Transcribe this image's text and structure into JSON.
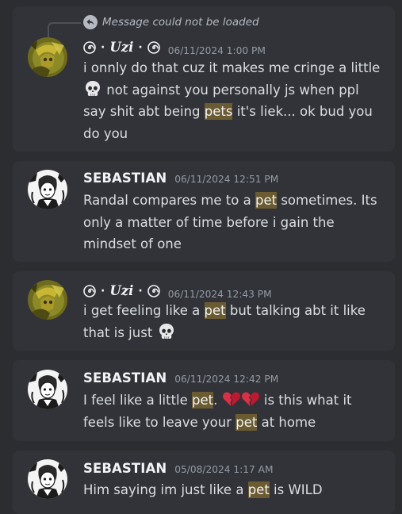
{
  "messages": [
    {
      "reply_text": "Message could not be loaded",
      "author": "Uzi",
      "author_prefix": "·",
      "author_suffix": "·",
      "timestamp": "06/11/2024 1:00 PM",
      "content": {
        "t1": "i onnly do that cuz it makes me cringe a little",
        "t2": " not against you personally js when ppl say shit abt being ",
        "hl1": "pets",
        "t3": " it's liek... ok bud you do you"
      }
    },
    {
      "author": "SEBASTIAN",
      "timestamp": "06/11/2024 12:51 PM",
      "content": {
        "t1": "Randal compares me to a ",
        "hl1": "pet",
        "t2": " sometimes. Its only a matter of time before i gain the mindset of one"
      }
    },
    {
      "author": "Uzi",
      "author_prefix": "·",
      "author_suffix": "·",
      "timestamp": "06/11/2024 12:43 PM",
      "content": {
        "t1": "i get feeling like a ",
        "hl1": "pet",
        "t2": " but talking abt it like that is just "
      }
    },
    {
      "author": "SEBASTIAN",
      "timestamp": "06/11/2024 12:42 PM",
      "content": {
        "t1": "I feel like a little ",
        "hl1": "pet",
        "t2": ". ",
        "t3": " is this what it feels like to leave your ",
        "hl2": "pet",
        "t4": "  at home"
      }
    },
    {
      "author": "SEBASTIAN",
      "timestamp": "05/08/2024 1:17 AM",
      "content": {
        "t1": "Him saying im just like a ",
        "hl1": "pet",
        "t2": " is WILD"
      }
    }
  ],
  "colors": {
    "background": "#2b2d31",
    "card": "#313338",
    "highlight": "#6b5b30",
    "text": "#dbdee1",
    "timestamp": "#949ba4"
  },
  "icons": [
    "reply-arrow-icon",
    "spiral-icon",
    "skull-emoji-icon",
    "broken-heart-emoji-icon"
  ]
}
